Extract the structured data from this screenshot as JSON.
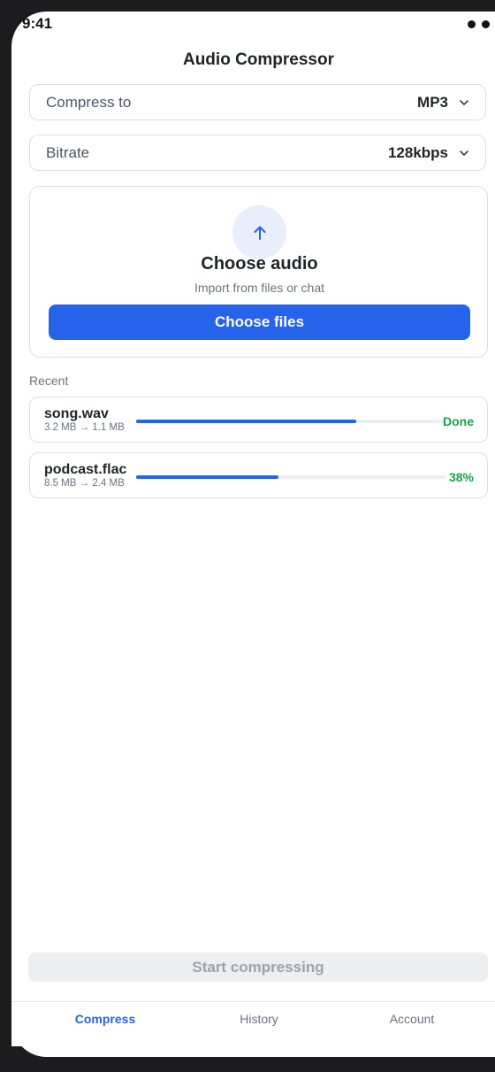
{
  "status_bar": {
    "time": "9:41"
  },
  "header": {
    "title": "Audio Compressor"
  },
  "format_select": {
    "label": "Compress to",
    "value": "MP3"
  },
  "bitrate_select": {
    "label": "Bitrate",
    "value": "128kbps"
  },
  "upload": {
    "icon": "arrow-up-icon",
    "title": "Choose audio",
    "subtitle": "Import from files or chat",
    "button_label": "Choose files"
  },
  "recent": {
    "label": "Recent",
    "items": [
      {
        "name": "song.wav",
        "sizes": "3.2 MB → 1.1 MB",
        "progress": 0.71,
        "status": "Done"
      },
      {
        "name": "podcast.flac",
        "sizes": "8.5 MB → 2.4 MB",
        "progress": 0.46,
        "status": "38%"
      }
    ]
  },
  "start_button": {
    "label": "Start compressing"
  },
  "tabs": [
    {
      "label": "Compress",
      "active": true
    },
    {
      "label": "History",
      "active": false
    },
    {
      "label": "Account",
      "active": false
    }
  ],
  "colors": {
    "accent": "#2563eb",
    "success": "#16a34a",
    "disabled_bg": "#eceef2"
  }
}
